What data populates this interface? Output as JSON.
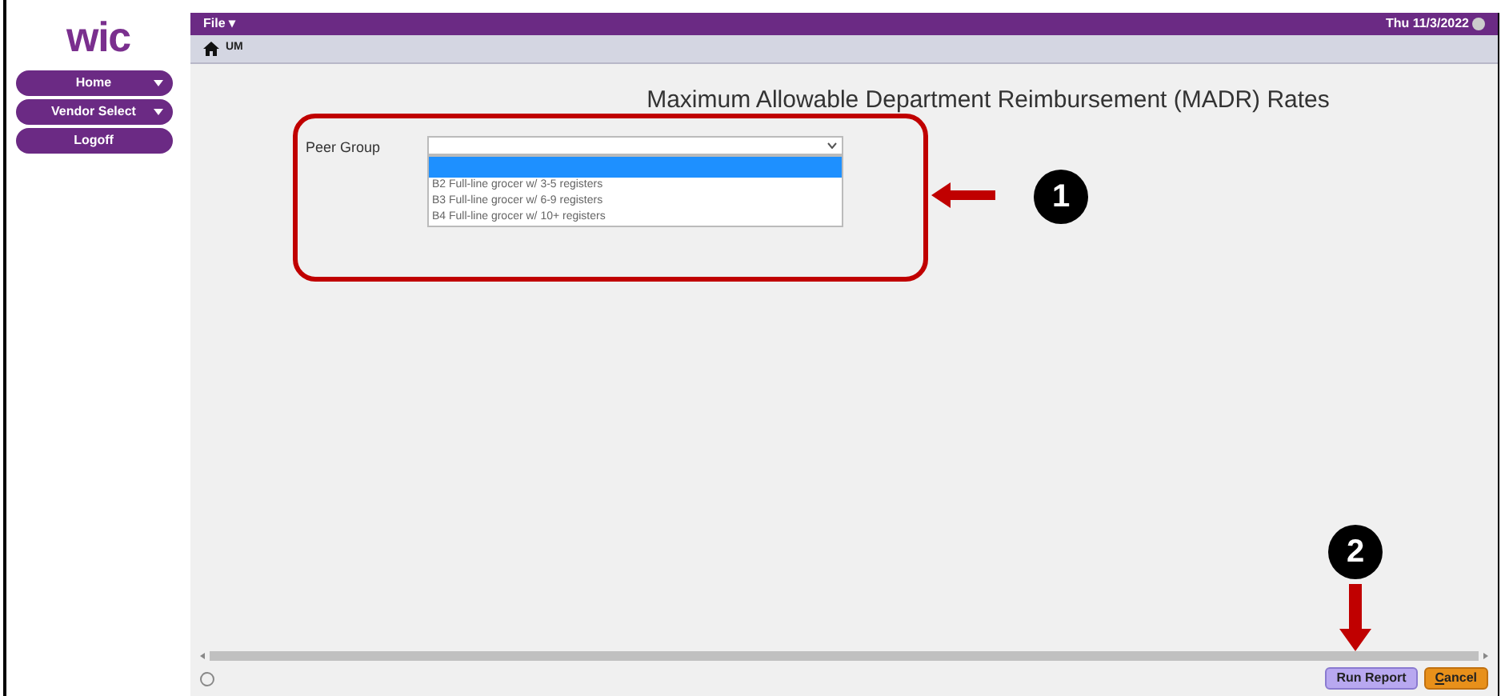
{
  "logo": {
    "text": "wic"
  },
  "sidebar": {
    "items": [
      {
        "label": "Home",
        "has_menu": true
      },
      {
        "label": "Vendor Select",
        "has_menu": true
      },
      {
        "label": "Logoff",
        "has_menu": false
      }
    ]
  },
  "menu_bar": {
    "menu": "File ▾",
    "date": "Thu 11/3/2022"
  },
  "breadcrumb": {
    "text": "UM"
  },
  "page": {
    "title": "Maximum Allowable Department Reimbursement (MADR) Rates",
    "peer_group": {
      "label": "Peer Group",
      "expanded": true,
      "options": [
        {
          "selected": true
        },
        {
          "label": "B2 Full-line grocer w/ 3-5 registers",
          "selected": false
        },
        {
          "label": "B3 Full-line grocer w/ 6-9 registers",
          "selected": false
        },
        {
          "label": "B4 Full-line grocer w/ 10+ registers",
          "selected": false
        }
      ]
    }
  },
  "callouts": [
    {
      "number": "1"
    },
    {
      "number": "2"
    }
  ],
  "buttons": [
    {
      "label": "Run Report",
      "kind": "primary"
    },
    {
      "label": "Cancel",
      "kind": "cancel"
    }
  ]
}
